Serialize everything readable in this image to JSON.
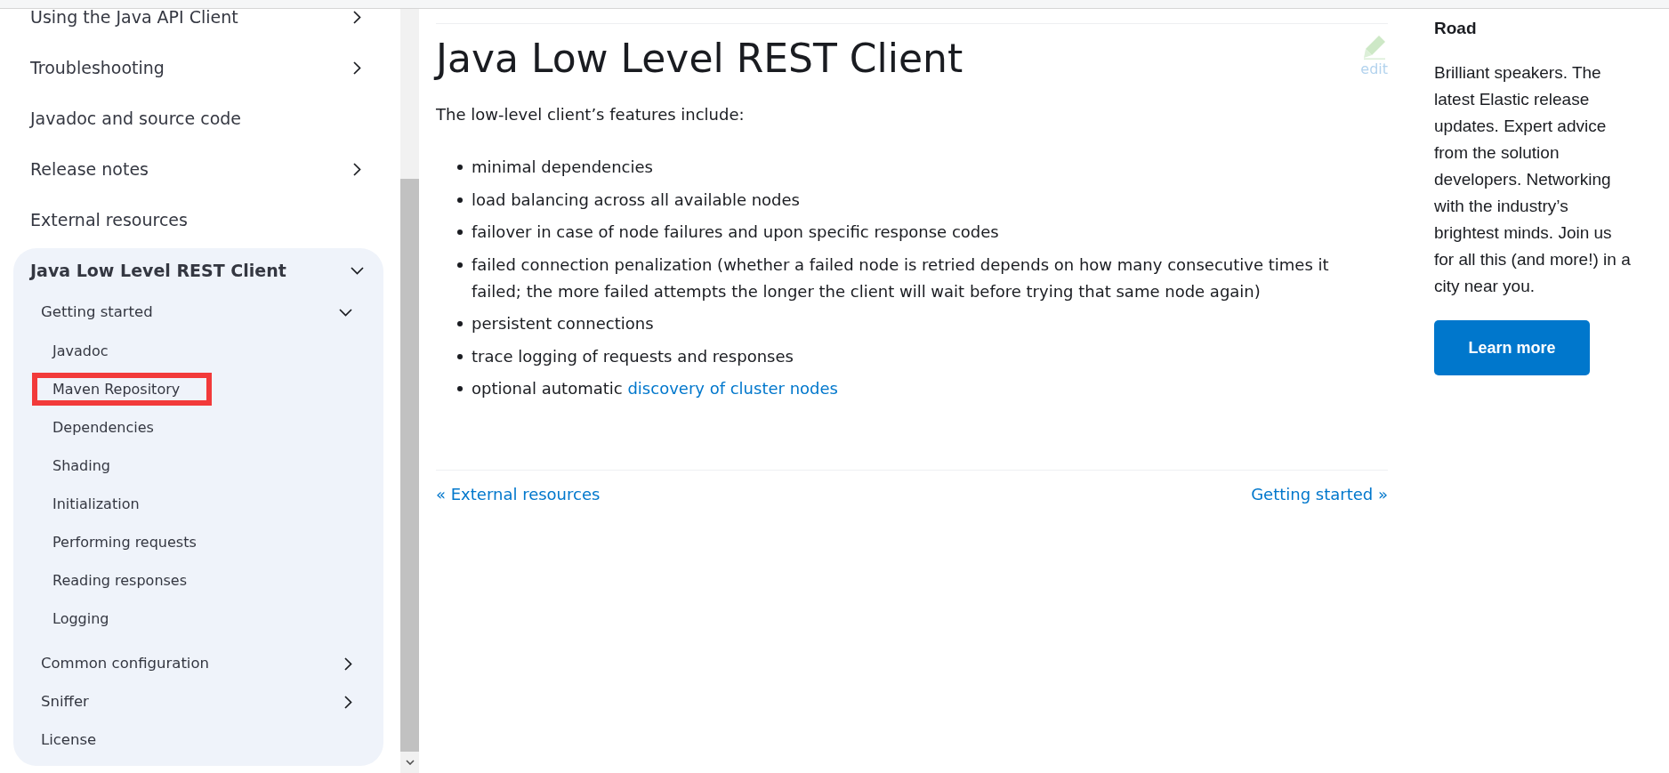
{
  "sidebar": {
    "items": [
      {
        "label": "Using the Java API Client",
        "kind": "group",
        "expanded": false,
        "selected": false
      },
      {
        "label": "Troubleshooting",
        "kind": "group",
        "expanded": false,
        "selected": false
      },
      {
        "label": "Javadoc and source code",
        "kind": "page",
        "selected": false
      },
      {
        "label": "Release notes",
        "kind": "group",
        "expanded": false,
        "selected": false
      },
      {
        "label": "External resources",
        "kind": "page",
        "selected": false
      },
      {
        "label": "Java Low Level REST Client",
        "kind": "group",
        "expanded": true,
        "selected": true,
        "children": [
          {
            "label": "Getting started",
            "kind": "group",
            "expanded": true,
            "children": [
              {
                "label": "Javadoc",
                "highlighted": false
              },
              {
                "label": "Maven Repository",
                "highlighted": true
              },
              {
                "label": "Dependencies",
                "highlighted": false
              },
              {
                "label": "Shading",
                "highlighted": false
              },
              {
                "label": "Initialization",
                "highlighted": false
              },
              {
                "label": "Performing requests",
                "highlighted": false
              },
              {
                "label": "Reading responses",
                "highlighted": false
              },
              {
                "label": "Logging",
                "highlighted": false
              }
            ]
          },
          {
            "label": "Common configuration",
            "kind": "group",
            "expanded": false
          },
          {
            "label": "Sniffer",
            "kind": "group",
            "expanded": false
          },
          {
            "label": "License",
            "kind": "page"
          }
        ]
      }
    ]
  },
  "article": {
    "title": "Java Low Level REST Client",
    "edit": "edit",
    "intro": "The low-level client’s features include:",
    "features": [
      {
        "text": "minimal dependencies"
      },
      {
        "text": "load balancing across all available nodes"
      },
      {
        "text": "failover in case of node failures and upon specific response codes"
      },
      {
        "text": "failed connection penalization (whether a failed node is retried depends on how many consecutive times it failed; the more failed attempts the longer the client will wait before trying that same node again)"
      },
      {
        "text": "persistent connections"
      },
      {
        "text": "trace logging of requests and responses"
      },
      {
        "text": "optional automatic",
        "link": "discovery of cluster nodes"
      }
    ],
    "pager": {
      "previous": "« External resources",
      "next": "Getting started »"
    }
  },
  "promo": {
    "heading": "Road",
    "text": "Brilliant speakers. The latest Elastic release updates. Expert advice from the solution developers. Networking with the industry’s brightest minds. Join us for all this (and more!) in a city near you.",
    "button": "Learn more"
  }
}
